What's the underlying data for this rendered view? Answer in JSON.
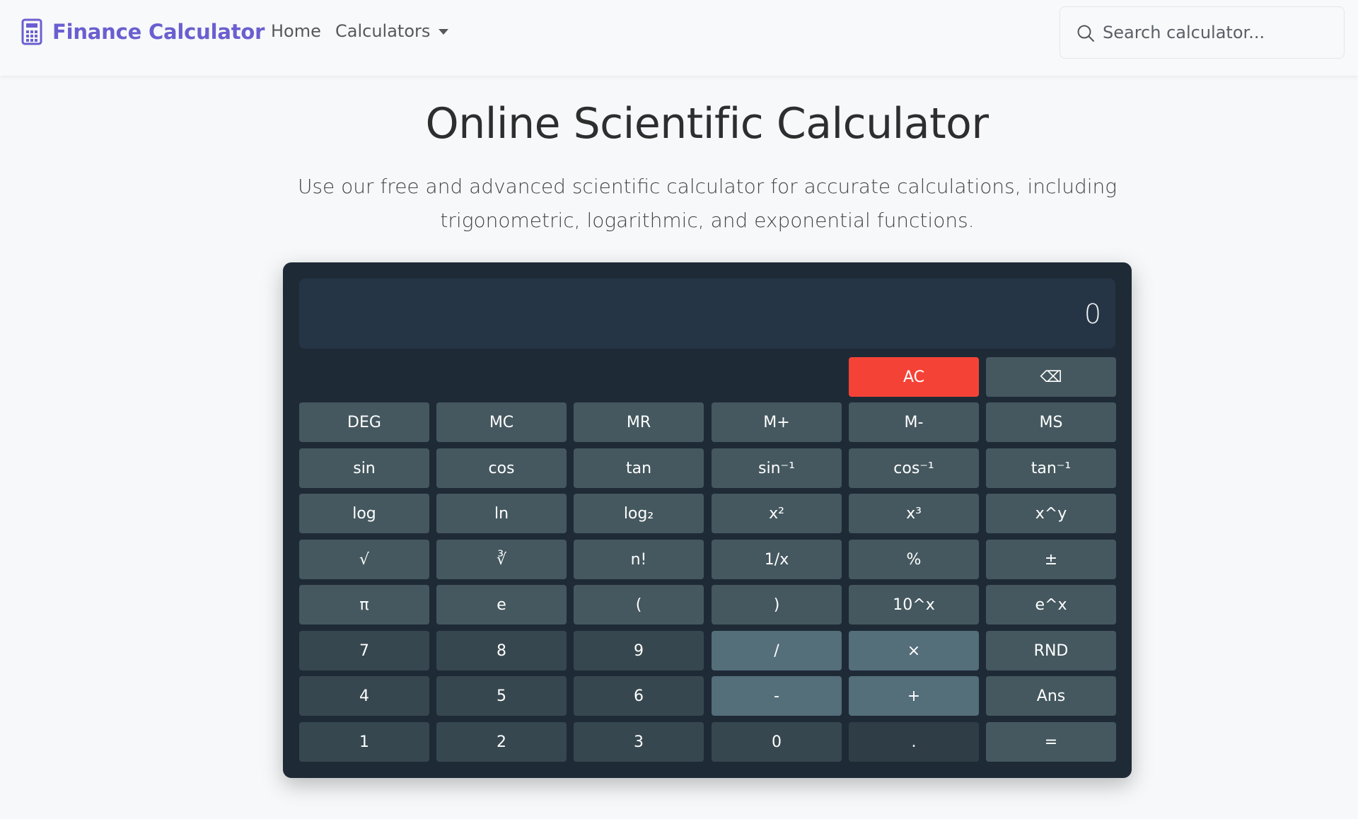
{
  "navbar": {
    "brand": "Finance Calculator",
    "links": {
      "home": "Home",
      "calculators": "Calculators"
    },
    "search_placeholder": "Search calculator..."
  },
  "hero": {
    "title": "Online Scientific Calculator",
    "subtitle": "Use our free and advanced scientific calculator for accurate calculations, including trigonometric, logarithmic, and exponential functions."
  },
  "calculator": {
    "display": "0",
    "buttons": {
      "ac": "AC",
      "backspace": "⌫",
      "deg": "DEG",
      "mc": "MC",
      "mr": "MR",
      "mplus": "M+",
      "mminus": "M-",
      "ms": "MS",
      "sin": "sin",
      "cos": "cos",
      "tan": "tan",
      "asin": "sin⁻¹",
      "acos": "cos⁻¹",
      "atan": "tan⁻¹",
      "log": "log",
      "ln": "ln",
      "log2": "log₂",
      "sq": "x²",
      "cube": "x³",
      "pow": "x^y",
      "sqrt": "√",
      "cbrt": "∛",
      "fact": "n!",
      "recip": "1/x",
      "percent": "%",
      "plusminus": "±",
      "pi": "π",
      "e": "e",
      "lparen": "(",
      "rparen": ")",
      "pow10": "10^x",
      "exp": "e^x",
      "n7": "7",
      "n8": "8",
      "n9": "9",
      "divide": "/",
      "multiply": "×",
      "rnd": "RND",
      "n4": "4",
      "n5": "5",
      "n6": "6",
      "minus": "-",
      "plus": "+",
      "ans": "Ans",
      "n1": "1",
      "n2": "2",
      "n3": "3",
      "n0": "0",
      "decimal": ".",
      "equals": "="
    }
  },
  "colors": {
    "brand": "#6a5fd0",
    "calc_bg": "#1f2a37",
    "display_bg": "#263545",
    "ac_red": "#f44336",
    "fn_btn": "#45585f",
    "num_btn": "#37474f",
    "op_btn": "#546e7a"
  }
}
